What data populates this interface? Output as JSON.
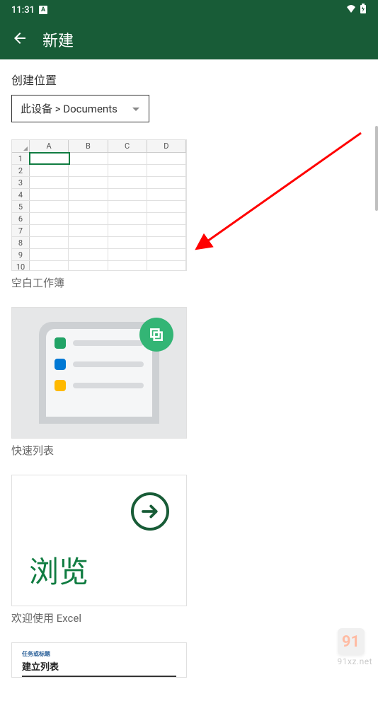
{
  "statusBar": {
    "time": "11:31",
    "notificationIcon": "A"
  },
  "header": {
    "title": "新建"
  },
  "location": {
    "label": "创建位置",
    "value": "此设备 > Documents"
  },
  "templates": {
    "blank": {
      "label": "空白工作簿",
      "columns": [
        "A",
        "B",
        "C",
        "D"
      ],
      "rows": [
        "1",
        "2",
        "3",
        "4",
        "5",
        "6",
        "7",
        "8",
        "9",
        "10"
      ]
    },
    "quickList": {
      "label": "快速列表"
    },
    "browse": {
      "label": "欢迎使用 Excel",
      "text": "浏览"
    },
    "buildList": {
      "subtitle": "任务或标题",
      "title": "建立列表"
    }
  },
  "watermark": {
    "logo": "91",
    "text": "91xz.net"
  }
}
